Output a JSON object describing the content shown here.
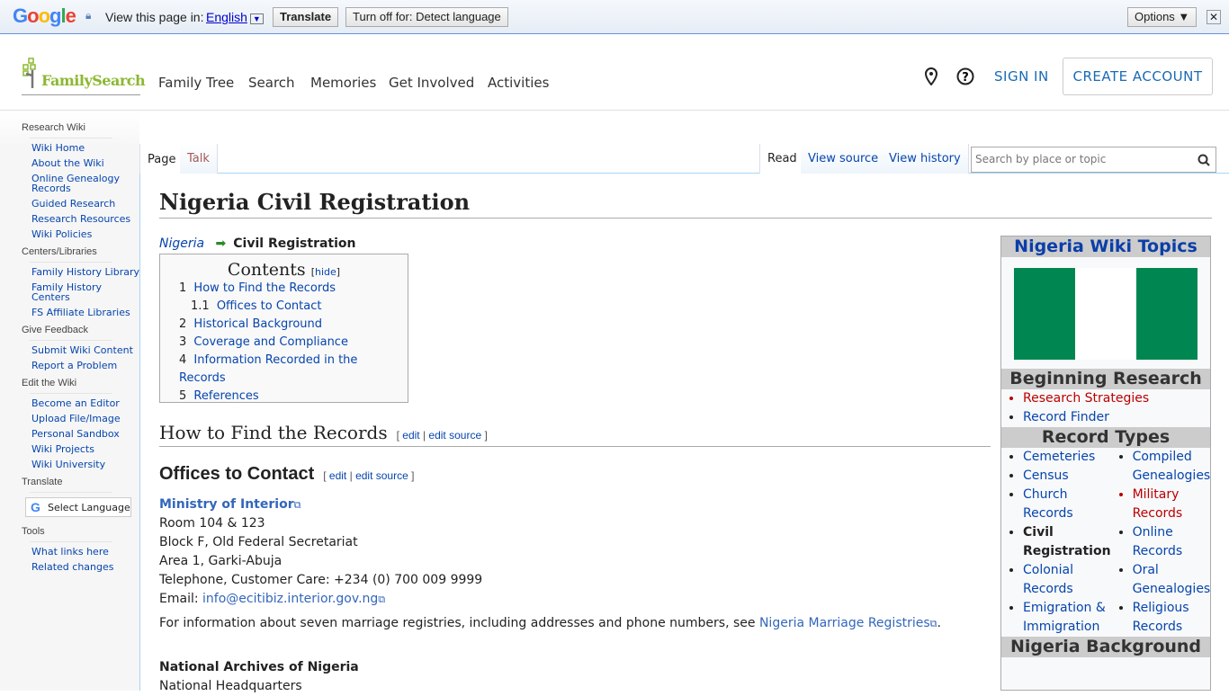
{
  "translate_bar": {
    "logo": "Google",
    "prompt": "View this page in:",
    "language": "English",
    "translate": "Translate",
    "turn_off": "Turn off for: Detect language",
    "options": "Options ▼",
    "close": "✕"
  },
  "header": {
    "logo": "FamilySearch",
    "nav": [
      "Family Tree",
      "Search",
      "Memories",
      "Get Involved",
      "Activities"
    ],
    "sign_in": "SIGN IN",
    "create_account": "CREATE ACCOUNT"
  },
  "sidebar": {
    "sections": [
      {
        "title": "Research Wiki",
        "items": [
          "Wiki Home",
          "About the Wiki",
          "Online Genealogy Records",
          "Guided Research",
          "Research Resources",
          "Wiki Policies"
        ]
      },
      {
        "title": "Centers/Libraries",
        "items": [
          "Family History Library",
          "Family History Centers",
          "FS Affiliate Libraries"
        ]
      },
      {
        "title": "Give Feedback",
        "items": [
          "Submit Wiki Content",
          "Report a Problem"
        ]
      },
      {
        "title": "Edit the Wiki",
        "items": [
          "Become an Editor",
          "Upload File/Image",
          "Personal Sandbox",
          "Wiki Projects",
          "Wiki University"
        ]
      }
    ],
    "translate_title": "Translate",
    "select_language": "Select Language",
    "tools_title": "Tools",
    "tools": [
      "What links here",
      "Related changes"
    ]
  },
  "tabs": {
    "page": "Page",
    "talk": "Talk",
    "read": "Read",
    "view_source": "View source",
    "view_history": "View history",
    "search_placeholder": "Search by place or topic"
  },
  "article": {
    "title": "Nigeria Civil Registration",
    "breadcrumb_parent": "Nigeria",
    "breadcrumb_current": "Civil Registration",
    "toc": {
      "title": "Contents",
      "hide": "hide",
      "items": [
        {
          "num": "1",
          "label": "How to Find the Records"
        },
        {
          "num": "1.1",
          "label": "Offices to Contact"
        },
        {
          "num": "2",
          "label": "Historical Background"
        },
        {
          "num": "3",
          "label": "Coverage and Compliance"
        },
        {
          "num": "4",
          "label": "Information Recorded in the Records"
        },
        {
          "num": "5",
          "label": "References"
        }
      ]
    },
    "h2": "How to Find the Records",
    "h3": "Offices to Contact",
    "edit": "edit",
    "edit_source": "edit source",
    "ministry": "Ministry of Interior",
    "address": [
      "Room 104 & 123",
      "Block F, Old Federal Secretariat",
      "Area 1, Garki-Abuja",
      "Telephone, Customer Care: +234 (0) 700 009 9999"
    ],
    "email_label": "Email:",
    "email": "info@ecitibiz.interior.gov.ng",
    "marriage_text": "For information about seven marriage registries, including addresses and phone numbers, see",
    "marriage_link": "Nigeria Marriage Registries",
    "archives": "National Archives of Nigeria",
    "archives_line": "National Headquarters"
  },
  "infobox": {
    "title": "Nigeria Wiki Topics",
    "flag_colors": [
      "#008751",
      "#ffffff",
      "#008751"
    ],
    "beginning": "Beginning Research",
    "beginning_items": [
      "Research Strategies",
      "Record Finder"
    ],
    "record_types": "Record Types",
    "col1": [
      "Cemeteries",
      "Census",
      "Church Records",
      "Civil Registration",
      "Colonial Records",
      "Emigration & Immigration"
    ],
    "col2": [
      "Compiled Genealogies",
      "Military Records",
      "Online Records",
      "Oral Genealogies",
      "Religious Records"
    ],
    "background": "Nigeria Background"
  }
}
